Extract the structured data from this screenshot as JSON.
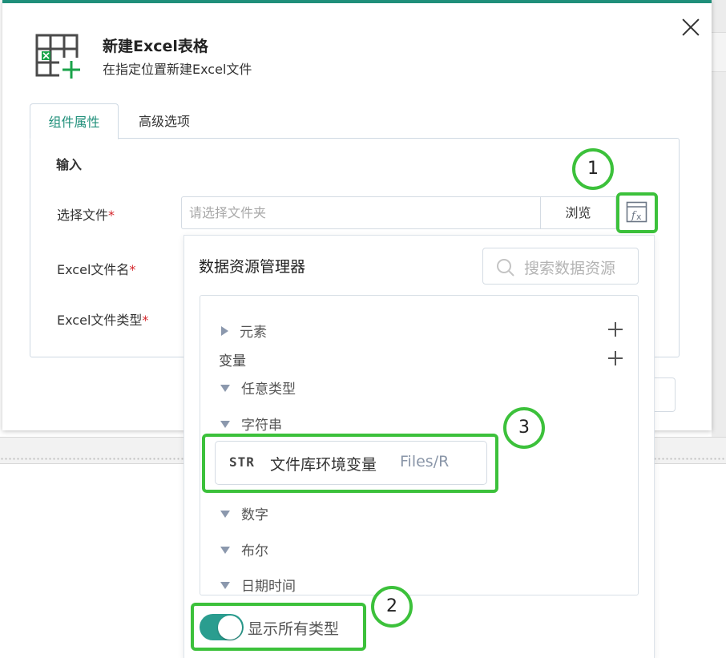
{
  "dialog": {
    "title": "新建Excel表格",
    "subtitle": "在指定位置新建Excel文件",
    "accent_color": "#1f8f7a",
    "icon": "excel-table-add-icon"
  },
  "tabs": [
    {
      "label": "组件属性",
      "active": true
    },
    {
      "label": "高级选项",
      "active": false
    }
  ],
  "form": {
    "section_title": "输入",
    "fields": [
      {
        "label": "选择文件",
        "required": true,
        "placeholder": "请选择文件夹",
        "value": ""
      },
      {
        "label": "Excel文件名",
        "required": true
      },
      {
        "label": "Excel文件类型",
        "required": true
      }
    ],
    "browse_label": "浏览",
    "required_mark": "*"
  },
  "callouts": [
    "1",
    "2",
    "3"
  ],
  "data_manager": {
    "title": "数据资源管理器",
    "search_placeholder": "搜索数据资源",
    "tree": {
      "elements_label": "元素",
      "variables_label": "变量",
      "categories": [
        "任意类型",
        "字符串",
        "数字",
        "布尔",
        "日期时间"
      ]
    },
    "variable_item": {
      "type_badge": "STR",
      "name": "文件库环境变量",
      "value": "Files/R"
    },
    "toggle": {
      "label": "显示所有类型",
      "on": true,
      "color": "#2a9d8f"
    }
  },
  "highlight_color": "#3cc13b"
}
